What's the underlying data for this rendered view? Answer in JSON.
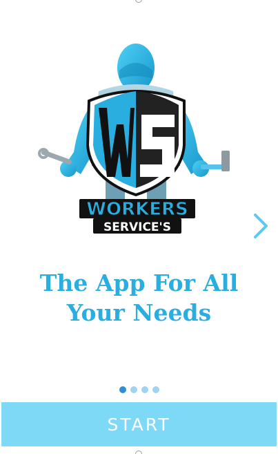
{
  "logo": {
    "monogram": "WS",
    "line1": "WORKERS",
    "line2": "SERVICE'S"
  },
  "next_icon": "chevron-right-icon",
  "tagline": {
    "line1": "The App For All",
    "line2": "Your Needs"
  },
  "pager": {
    "total": 4,
    "active_index": 0
  },
  "start_button": {
    "label": "START"
  },
  "colors": {
    "accent": "#2aaee0",
    "button_bg": "#7ed9f7",
    "dot_active": "#2f8ed6",
    "dot_inactive": "#9fd3f0"
  }
}
